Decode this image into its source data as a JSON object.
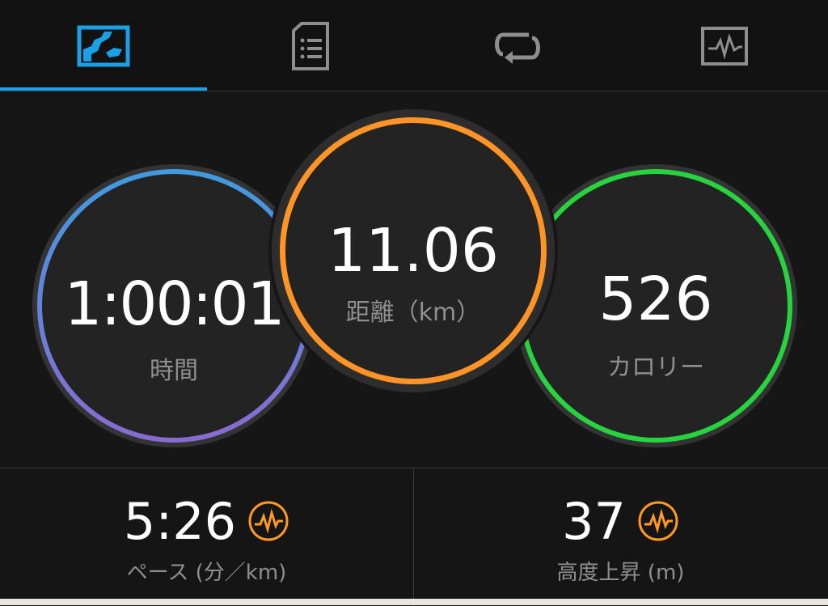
{
  "tabs": [
    {
      "icon": "map-icon",
      "active": true
    },
    {
      "icon": "document-list-icon",
      "active": false
    },
    {
      "icon": "laps-repeat-icon",
      "active": false
    },
    {
      "icon": "graph-icon",
      "active": false
    }
  ],
  "metrics": {
    "time": {
      "value": "1:00:01",
      "label": "時間"
    },
    "distance": {
      "value": "11.06",
      "label": "距離（km）"
    },
    "calories": {
      "value": "526",
      "label": "カロリー"
    }
  },
  "stats": {
    "pace": {
      "value": "5:26",
      "label": "ペース (分／km)",
      "icon": "chart-pulse-icon"
    },
    "elevation": {
      "value": "37",
      "label": "高度上昇 (m)",
      "icon": "chart-pulse-icon"
    }
  },
  "colors": {
    "tab_active": "#1aa0e6",
    "time_ring_top": "#3f9be0",
    "time_ring_bottom": "#8a6ad0",
    "distance_ring": "#ff9426",
    "calories_ring": "#27d33f",
    "stat_icon": "#ff9a1f"
  }
}
